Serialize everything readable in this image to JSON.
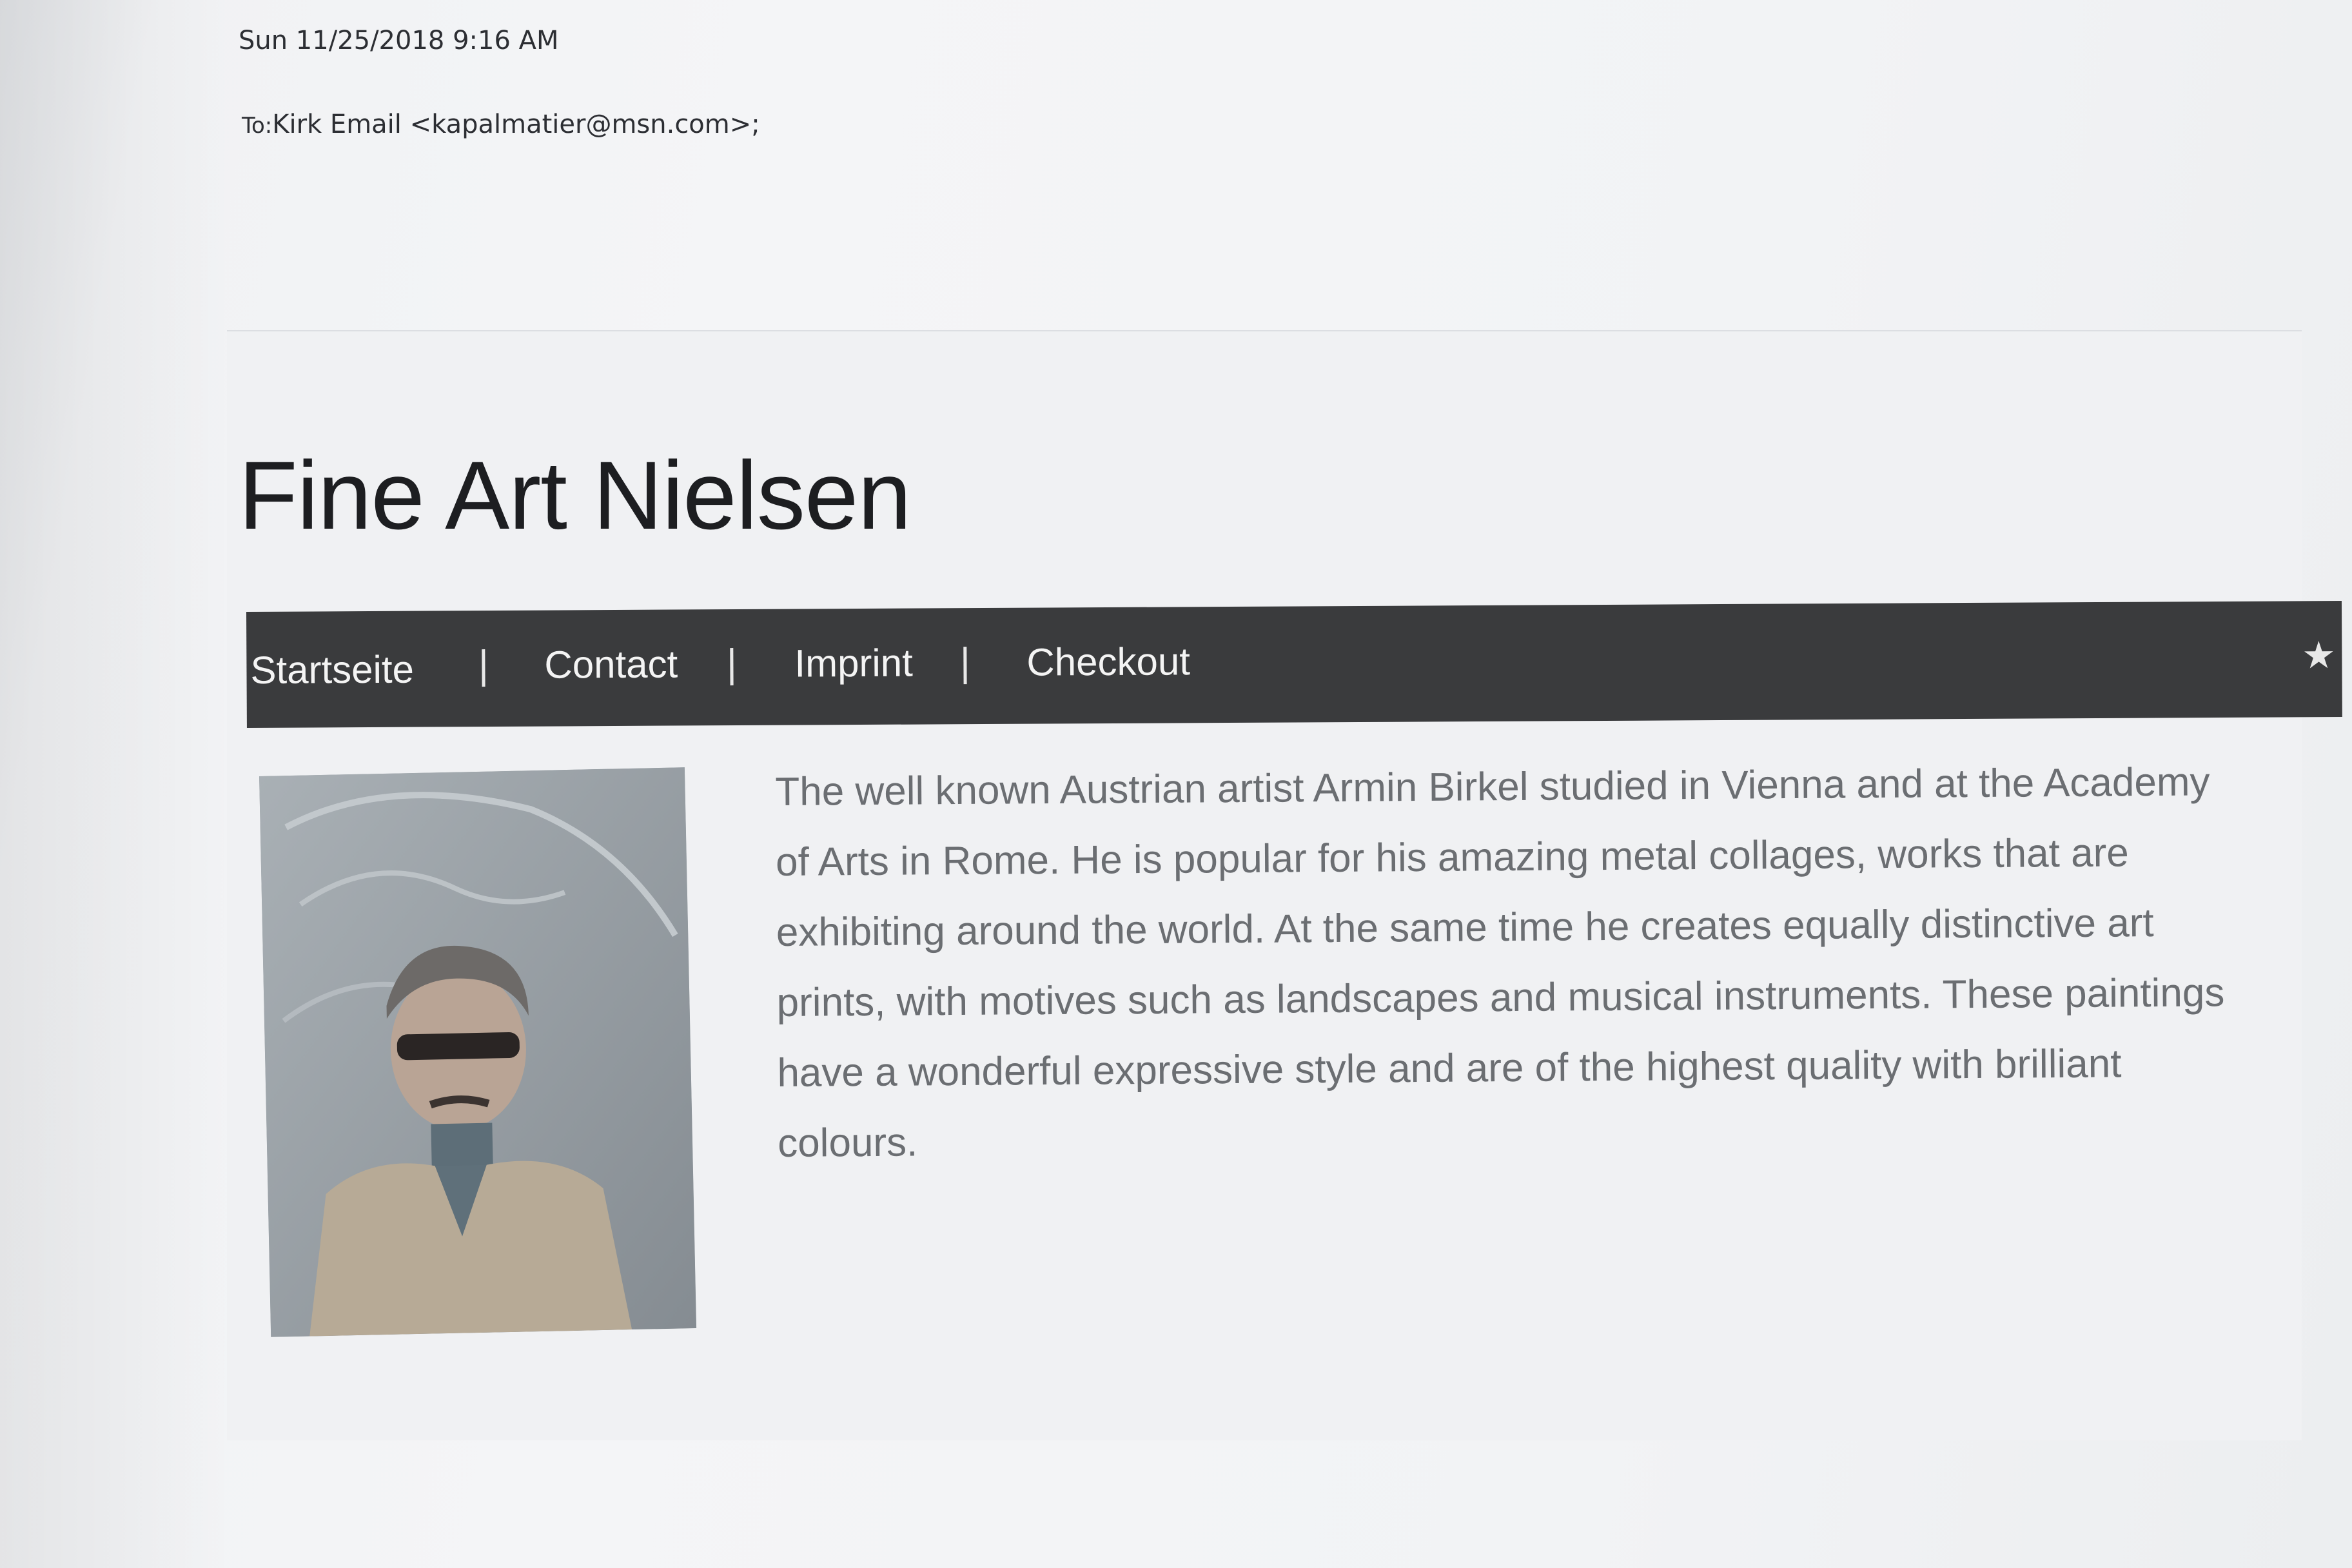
{
  "email": {
    "date": "Sun 11/25/2018 9:16 AM",
    "to_label": "To:",
    "to_value": "Kirk Email <kapalmatier@msn.com>;"
  },
  "website": {
    "title": "Fine Art Nielsen",
    "nav": {
      "items": [
        "Startseite",
        "Contact",
        "Imprint",
        "Checkout"
      ],
      "separator": "|"
    },
    "bio": "The well known Austrian artist Armin Birkel studied in Vienna and at the Academy of Arts in Rome. He is popular for his amazing metal collages, works that are exhibiting around the world. At the same time he creates equally distinctive art prints, with motives such as landscapes and musical instruments. These paintings have a wonderful expressive style and are of the highest quality with brilliant colours."
  },
  "colors": {
    "nav_background": "#3a3b3d",
    "nav_text": "#f4f4f4",
    "title_text": "#1d1e21",
    "body_text": "#6b6e72"
  },
  "icons": {
    "nav_right": "star-icon"
  }
}
